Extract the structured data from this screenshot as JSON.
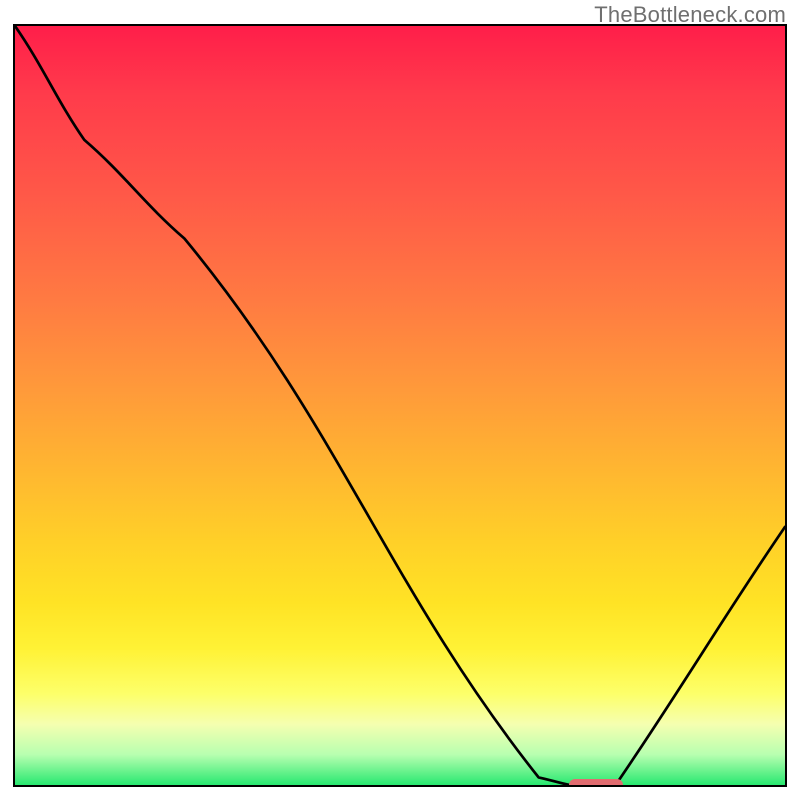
{
  "watermark": "TheBottleneck.com",
  "colors": {
    "frame_border": "#000000",
    "watermark_text": "#6f6f6f",
    "curve_stroke": "#000000",
    "marker": "#e16c70",
    "gradient_top": "#ff1e4a",
    "gradient_bottom": "#28e870"
  },
  "chart_data": {
    "type": "line",
    "title": "",
    "xlabel": "",
    "ylabel": "",
    "xlim": [
      0,
      100
    ],
    "ylim": [
      0,
      100
    ],
    "series": [
      {
        "name": "bottleneck-curve",
        "x": [
          0,
          9,
          22,
          68,
          72,
          78,
          100
        ],
        "y": [
          100,
          85,
          72,
          1,
          0,
          0,
          34
        ]
      }
    ],
    "annotations": [
      {
        "name": "optimal-marker",
        "x_start": 72,
        "x_end": 79,
        "y": 0
      }
    ],
    "grid": false,
    "legend": false
  }
}
